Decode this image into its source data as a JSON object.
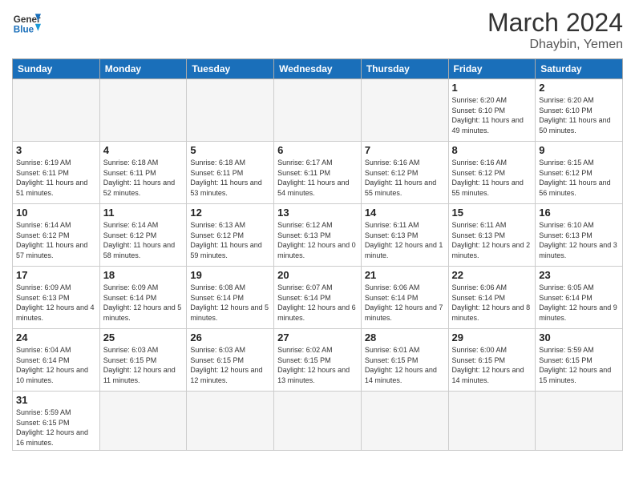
{
  "header": {
    "logo_general": "General",
    "logo_blue": "Blue",
    "title": "March 2024",
    "location": "Dhaybin, Yemen"
  },
  "days_of_week": [
    "Sunday",
    "Monday",
    "Tuesday",
    "Wednesday",
    "Thursday",
    "Friday",
    "Saturday"
  ],
  "weeks": [
    [
      {
        "day": "",
        "info": ""
      },
      {
        "day": "",
        "info": ""
      },
      {
        "day": "",
        "info": ""
      },
      {
        "day": "",
        "info": ""
      },
      {
        "day": "",
        "info": ""
      },
      {
        "day": "1",
        "info": "Sunrise: 6:20 AM\nSunset: 6:10 PM\nDaylight: 11 hours\nand 49 minutes."
      },
      {
        "day": "2",
        "info": "Sunrise: 6:20 AM\nSunset: 6:10 PM\nDaylight: 11 hours\nand 50 minutes."
      }
    ],
    [
      {
        "day": "3",
        "info": "Sunrise: 6:19 AM\nSunset: 6:11 PM\nDaylight: 11 hours\nand 51 minutes."
      },
      {
        "day": "4",
        "info": "Sunrise: 6:18 AM\nSunset: 6:11 PM\nDaylight: 11 hours\nand 52 minutes."
      },
      {
        "day": "5",
        "info": "Sunrise: 6:18 AM\nSunset: 6:11 PM\nDaylight: 11 hours\nand 53 minutes."
      },
      {
        "day": "6",
        "info": "Sunrise: 6:17 AM\nSunset: 6:11 PM\nDaylight: 11 hours\nand 54 minutes."
      },
      {
        "day": "7",
        "info": "Sunrise: 6:16 AM\nSunset: 6:12 PM\nDaylight: 11 hours\nand 55 minutes."
      },
      {
        "day": "8",
        "info": "Sunrise: 6:16 AM\nSunset: 6:12 PM\nDaylight: 11 hours\nand 55 minutes."
      },
      {
        "day": "9",
        "info": "Sunrise: 6:15 AM\nSunset: 6:12 PM\nDaylight: 11 hours\nand 56 minutes."
      }
    ],
    [
      {
        "day": "10",
        "info": "Sunrise: 6:14 AM\nSunset: 6:12 PM\nDaylight: 11 hours\nand 57 minutes."
      },
      {
        "day": "11",
        "info": "Sunrise: 6:14 AM\nSunset: 6:12 PM\nDaylight: 11 hours\nand 58 minutes."
      },
      {
        "day": "12",
        "info": "Sunrise: 6:13 AM\nSunset: 6:12 PM\nDaylight: 11 hours\nand 59 minutes."
      },
      {
        "day": "13",
        "info": "Sunrise: 6:12 AM\nSunset: 6:13 PM\nDaylight: 12 hours\nand 0 minutes."
      },
      {
        "day": "14",
        "info": "Sunrise: 6:11 AM\nSunset: 6:13 PM\nDaylight: 12 hours\nand 1 minute."
      },
      {
        "day": "15",
        "info": "Sunrise: 6:11 AM\nSunset: 6:13 PM\nDaylight: 12 hours\nand 2 minutes."
      },
      {
        "day": "16",
        "info": "Sunrise: 6:10 AM\nSunset: 6:13 PM\nDaylight: 12 hours\nand 3 minutes."
      }
    ],
    [
      {
        "day": "17",
        "info": "Sunrise: 6:09 AM\nSunset: 6:13 PM\nDaylight: 12 hours\nand 4 minutes."
      },
      {
        "day": "18",
        "info": "Sunrise: 6:09 AM\nSunset: 6:14 PM\nDaylight: 12 hours\nand 5 minutes."
      },
      {
        "day": "19",
        "info": "Sunrise: 6:08 AM\nSunset: 6:14 PM\nDaylight: 12 hours\nand 5 minutes."
      },
      {
        "day": "20",
        "info": "Sunrise: 6:07 AM\nSunset: 6:14 PM\nDaylight: 12 hours\nand 6 minutes."
      },
      {
        "day": "21",
        "info": "Sunrise: 6:06 AM\nSunset: 6:14 PM\nDaylight: 12 hours\nand 7 minutes."
      },
      {
        "day": "22",
        "info": "Sunrise: 6:06 AM\nSunset: 6:14 PM\nDaylight: 12 hours\nand 8 minutes."
      },
      {
        "day": "23",
        "info": "Sunrise: 6:05 AM\nSunset: 6:14 PM\nDaylight: 12 hours\nand 9 minutes."
      }
    ],
    [
      {
        "day": "24",
        "info": "Sunrise: 6:04 AM\nSunset: 6:14 PM\nDaylight: 12 hours\nand 10 minutes."
      },
      {
        "day": "25",
        "info": "Sunrise: 6:03 AM\nSunset: 6:15 PM\nDaylight: 12 hours\nand 11 minutes."
      },
      {
        "day": "26",
        "info": "Sunrise: 6:03 AM\nSunset: 6:15 PM\nDaylight: 12 hours\nand 12 minutes."
      },
      {
        "day": "27",
        "info": "Sunrise: 6:02 AM\nSunset: 6:15 PM\nDaylight: 12 hours\nand 13 minutes."
      },
      {
        "day": "28",
        "info": "Sunrise: 6:01 AM\nSunset: 6:15 PM\nDaylight: 12 hours\nand 14 minutes."
      },
      {
        "day": "29",
        "info": "Sunrise: 6:00 AM\nSunset: 6:15 PM\nDaylight: 12 hours\nand 14 minutes."
      },
      {
        "day": "30",
        "info": "Sunrise: 5:59 AM\nSunset: 6:15 PM\nDaylight: 12 hours\nand 15 minutes."
      }
    ],
    [
      {
        "day": "31",
        "info": "Sunrise: 5:59 AM\nSunset: 6:15 PM\nDaylight: 12 hours\nand 16 minutes."
      },
      {
        "day": "",
        "info": ""
      },
      {
        "day": "",
        "info": ""
      },
      {
        "day": "",
        "info": ""
      },
      {
        "day": "",
        "info": ""
      },
      {
        "day": "",
        "info": ""
      },
      {
        "day": "",
        "info": ""
      }
    ]
  ]
}
